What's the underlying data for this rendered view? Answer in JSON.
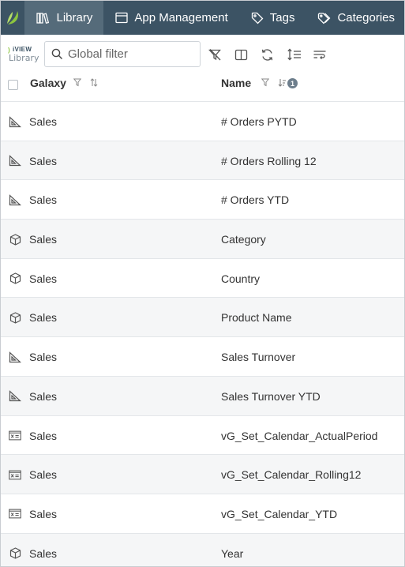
{
  "nav": {
    "tabs": [
      {
        "label": "Library",
        "icon": "library-icon",
        "active": true
      },
      {
        "label": "App Management",
        "icon": "window-icon",
        "active": false
      },
      {
        "label": "Tags",
        "icon": "tag-icon",
        "active": false
      },
      {
        "label": "Categories",
        "icon": "categories-icon",
        "active": false
      }
    ]
  },
  "brand": {
    "line1": "iVIEW",
    "line2": "Library"
  },
  "search": {
    "placeholder": "Global filter",
    "value": ""
  },
  "toolbar": {
    "icons": [
      "clear-filter-icon",
      "columns-icon",
      "refresh-icon",
      "row-height-icon",
      "wrap-text-icon"
    ]
  },
  "table": {
    "columns": [
      {
        "label": "Galaxy",
        "icons": [
          "filter-icon",
          "sort-icon"
        ]
      },
      {
        "label": "Name",
        "icons": [
          "filter-icon",
          "sort-asc-icon"
        ],
        "sort_order": "1"
      }
    ],
    "rows": [
      {
        "icon": "measure-icon",
        "galaxy": "Sales",
        "name": "# Orders PYTD"
      },
      {
        "icon": "measure-icon",
        "galaxy": "Sales",
        "name": "# Orders Rolling 12"
      },
      {
        "icon": "measure-icon",
        "galaxy": "Sales",
        "name": "# Orders YTD"
      },
      {
        "icon": "dimension-icon",
        "galaxy": "Sales",
        "name": "Category"
      },
      {
        "icon": "dimension-icon",
        "galaxy": "Sales",
        "name": "Country"
      },
      {
        "icon": "dimension-icon",
        "galaxy": "Sales",
        "name": "Product Name"
      },
      {
        "icon": "measure-icon",
        "galaxy": "Sales",
        "name": "Sales Turnover"
      },
      {
        "icon": "measure-icon",
        "galaxy": "Sales",
        "name": "Sales Turnover YTD"
      },
      {
        "icon": "variable-icon",
        "galaxy": "Sales",
        "name": "vG_Set_Calendar_ActualPeriod"
      },
      {
        "icon": "variable-icon",
        "galaxy": "Sales",
        "name": "vG_Set_Calendar_Rolling12"
      },
      {
        "icon": "variable-icon",
        "galaxy": "Sales",
        "name": "vG_Set_Calendar_YTD"
      },
      {
        "icon": "dimension-icon",
        "galaxy": "Sales",
        "name": "Year"
      }
    ]
  },
  "colors": {
    "nav_bg": "#3c5364",
    "nav_active": "#556b7a",
    "brand_green": "#8dc63f",
    "row_alt": "#f5f6f7"
  }
}
